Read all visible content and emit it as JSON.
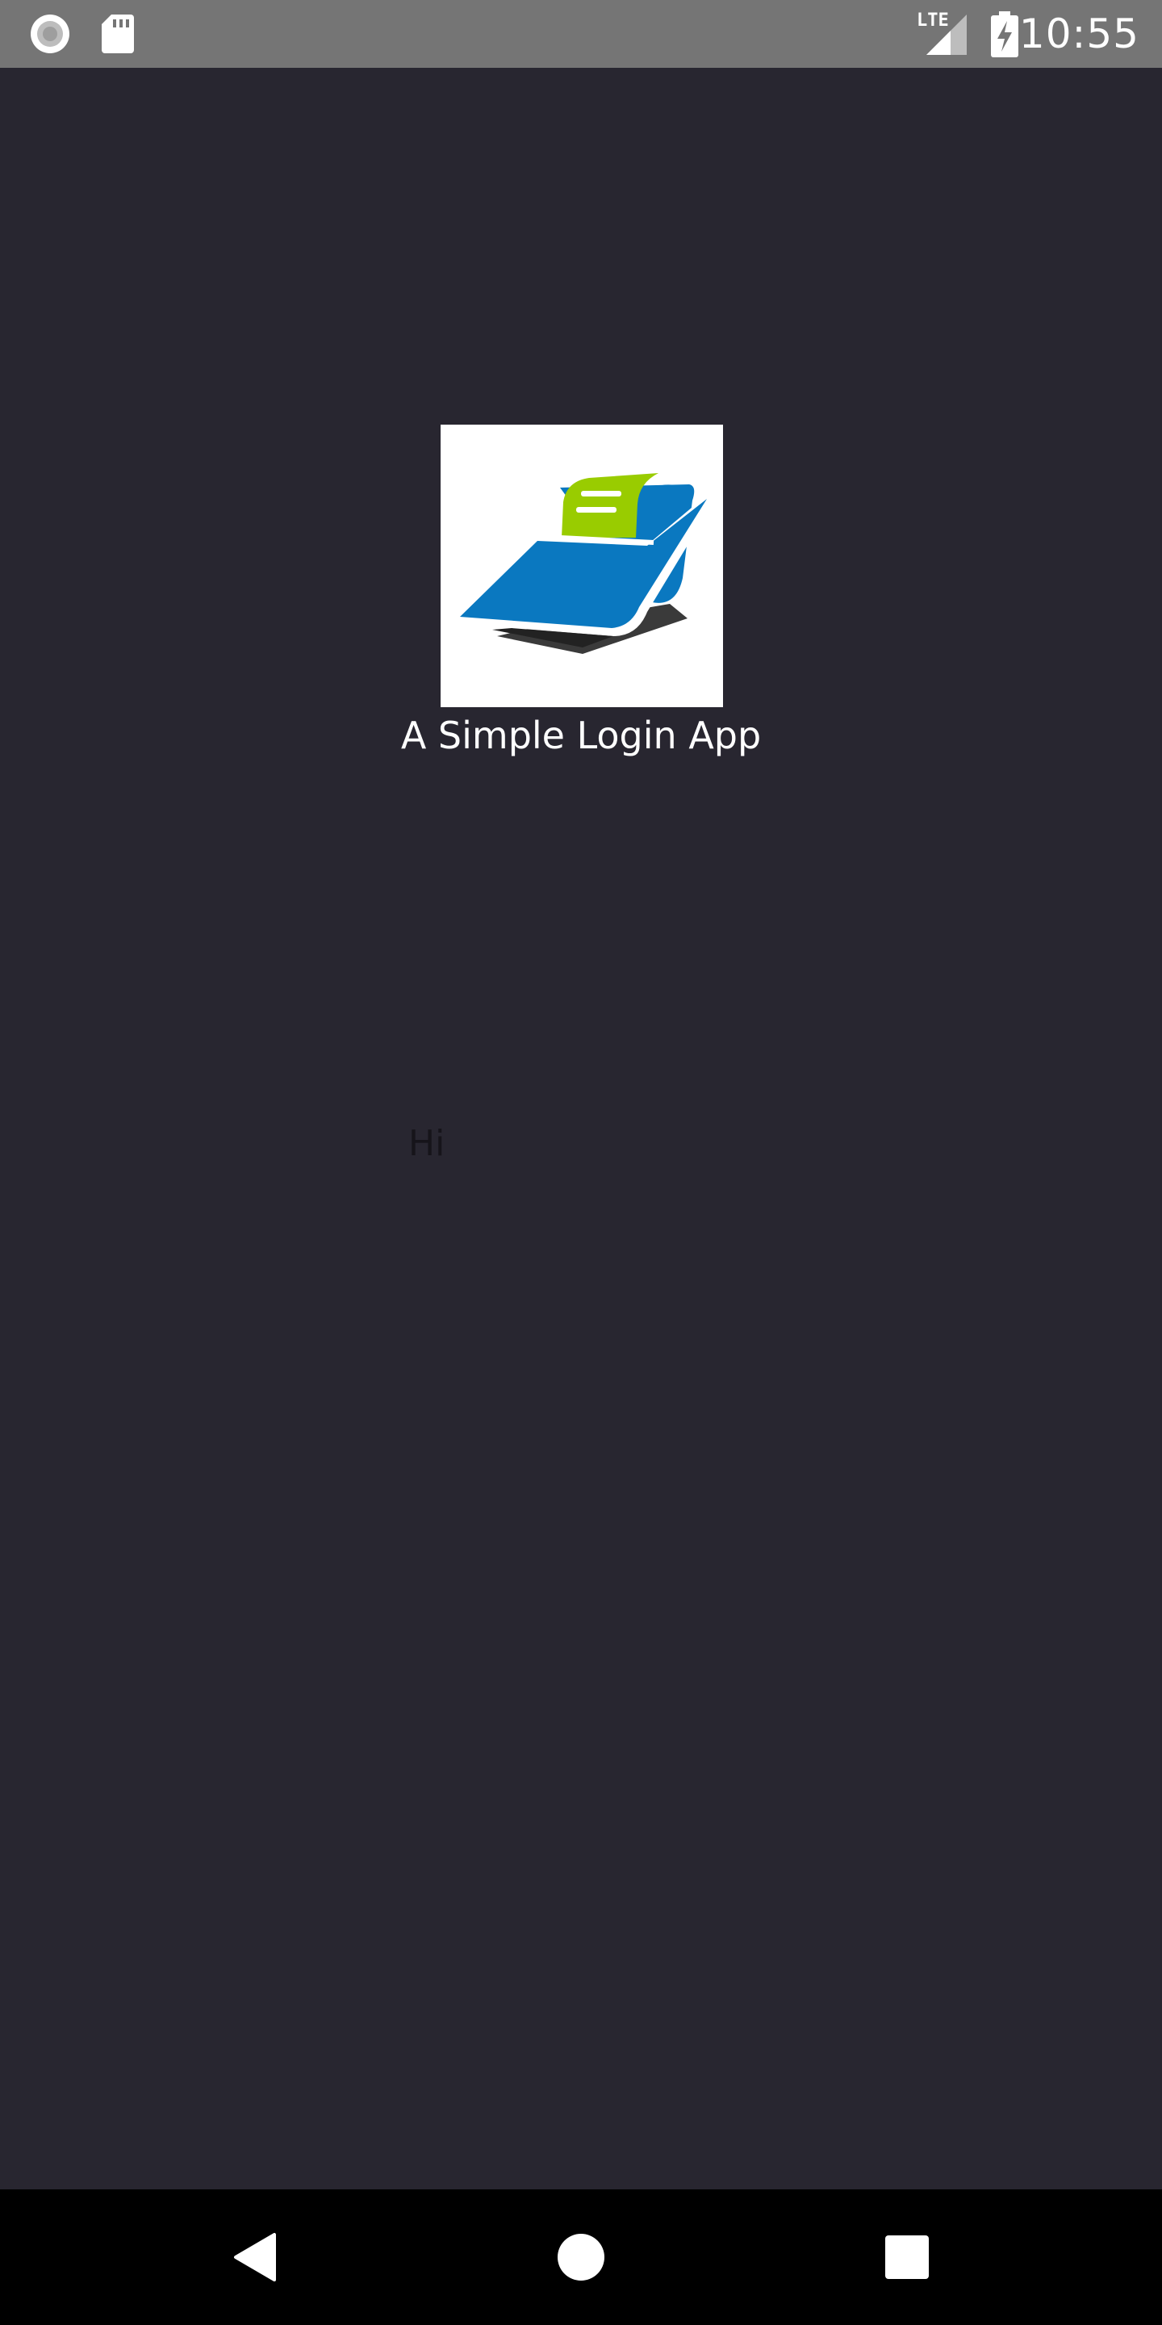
{
  "status_bar": {
    "time": "10:55",
    "network_label": "LTE",
    "icons": [
      "record-icon",
      "sd-card-icon",
      "signal-icon",
      "battery-charging-icon"
    ]
  },
  "app": {
    "title": "A Simple Login App",
    "greeting": "Hi",
    "logo": "receipt-printer-logo"
  },
  "nav_bar": {
    "buttons": [
      "back-icon",
      "home-icon",
      "recents-icon"
    ]
  },
  "colors": {
    "background": "#282630",
    "status_bar": "#757575",
    "nav_bar": "#000000",
    "logo_blue": "#0A78C0",
    "logo_green": "#99CC00",
    "greeting_text": "#16141a"
  }
}
